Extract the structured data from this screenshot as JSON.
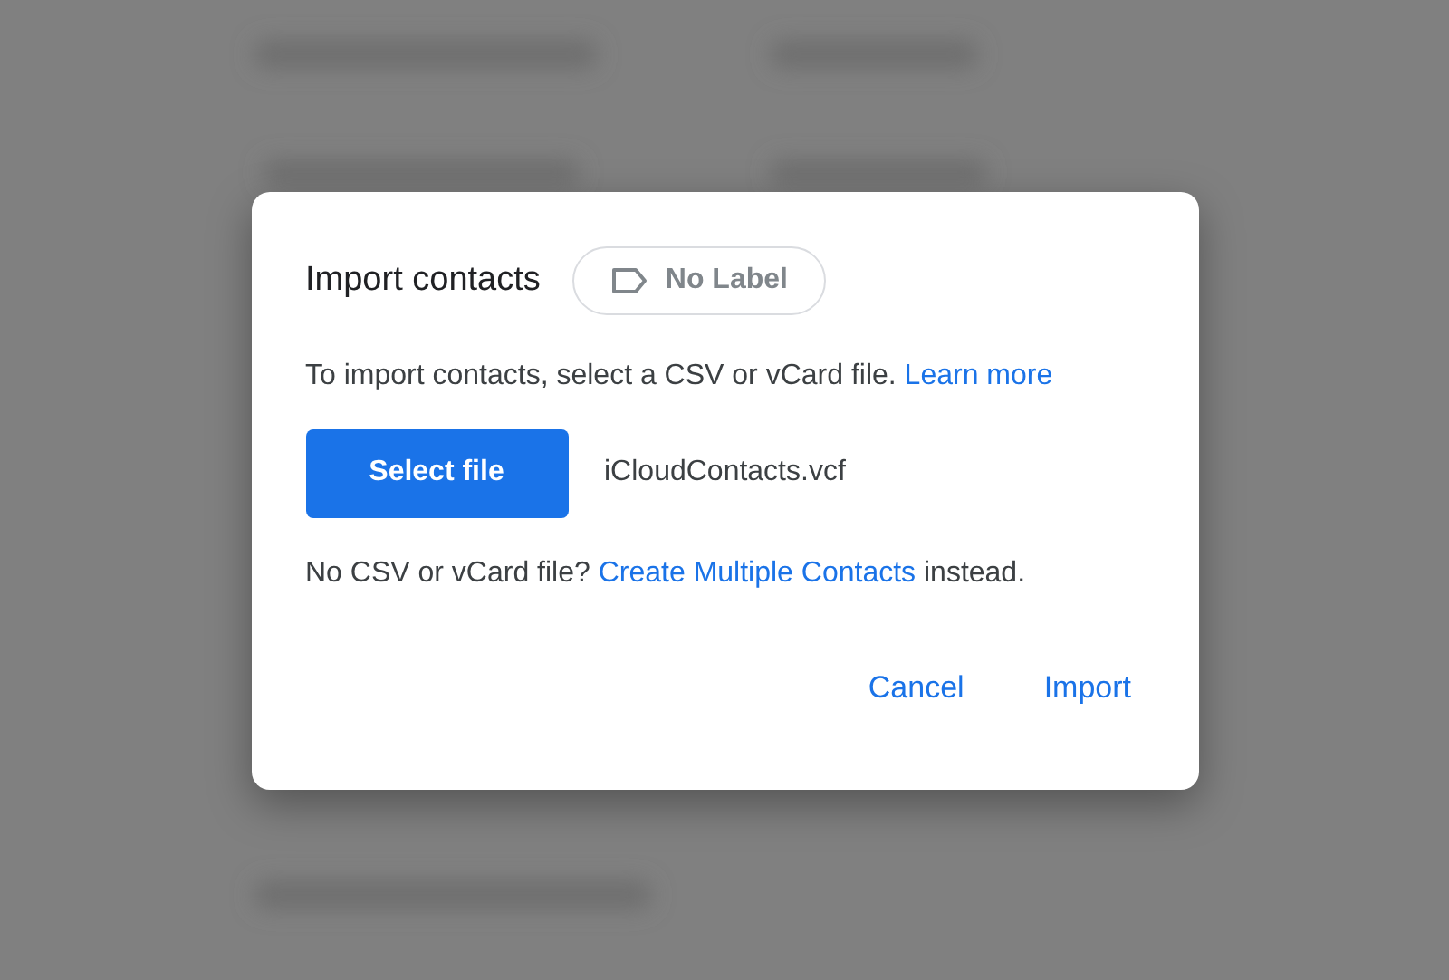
{
  "dialog": {
    "title": "Import contacts",
    "label_chip": {
      "text": "No Label"
    },
    "description": {
      "text": "To import contacts, select a CSV or vCard file.",
      "link": "Learn more"
    },
    "select_button": "Select file",
    "file_name": "iCloudContacts.vcf",
    "alternative": {
      "before": "No CSV or vCard file?",
      "link": "Create Multiple Contacts",
      "after": "instead."
    },
    "actions": [
      "Cancel",
      "Import"
    ]
  }
}
